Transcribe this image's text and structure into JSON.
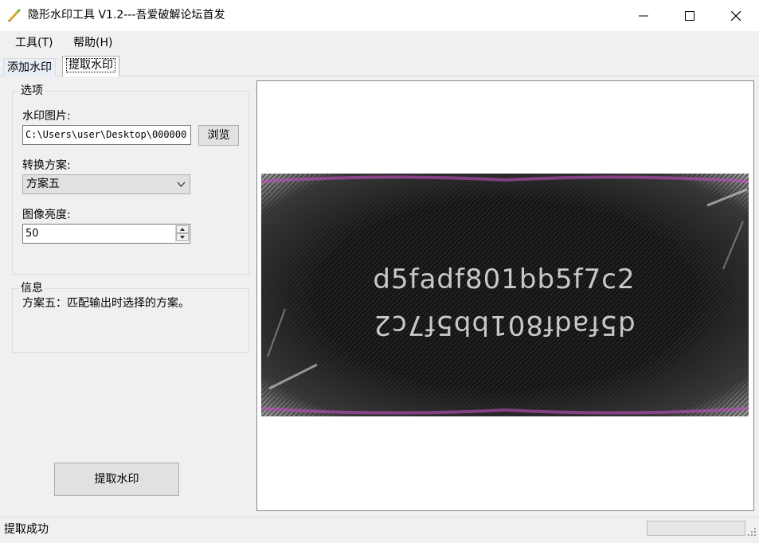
{
  "window": {
    "title": "隐形水印工具 V1.2---吾爱破解论坛首发",
    "minimize_icon": "minimize-icon",
    "maximize_icon": "maximize-icon",
    "close_icon": "close-icon"
  },
  "menu": {
    "tools": "工具(T)",
    "help": "帮助(H)"
  },
  "tabs": {
    "add": "添加水印",
    "extract": "提取水印",
    "active": "extract"
  },
  "options": {
    "legend": "选项",
    "image_label": "水印图片:",
    "image_path": "C:\\Users\\user\\Desktop\\000000",
    "browse_label": "浏览",
    "scheme_label": "转换方案:",
    "scheme_value": "方案五",
    "brightness_label": "图像亮度:",
    "brightness_value": "50"
  },
  "info": {
    "legend": "信息",
    "text": "方案五：匹配输出时选择的方案。"
  },
  "extract_button": "提取水印",
  "preview": {
    "line1": "d5fadf801bb5f7c2",
    "line2": "d5fadf801bb5f7c2"
  },
  "status": {
    "text": "提取成功",
    "progress": 0
  }
}
